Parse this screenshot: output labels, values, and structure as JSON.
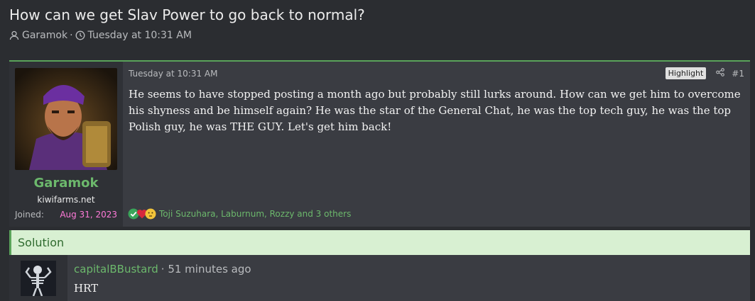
{
  "thread": {
    "title": "How can we get Slav Power to go back to normal?",
    "author": "Garamok",
    "separator": "·",
    "date": "Tuesday at 10:31 AM"
  },
  "post": {
    "date": "Tuesday at 10:31 AM",
    "highlight_label": "Highlight",
    "number": "#1",
    "body": "He seems to have stopped posting a month ago but probably still lurks around. How can we get him to overcome his shyness and be himself again? He was the star of the General Chat, he was the top tech guy, he was the top Polish guy, he was THE GUY. Let's get him back!",
    "user": {
      "name": "Garamok",
      "title": "kiwifarms.net",
      "joined_label": "Joined:",
      "joined_value": "Aug 31, 2023"
    },
    "reactions": {
      "icons": [
        "check-icon",
        "heart-icon",
        "thinking-face-icon"
      ],
      "names": "Toji Suzuhara, Laburnum, Rozzy and 3 others"
    }
  },
  "solution": {
    "label": "Solution",
    "username": "capitalBBustard",
    "time": "· 51 minutes ago",
    "body": "HRT"
  },
  "colors": {
    "accent_green": "#6cb86c",
    "joined_pink": "#ff7ad9",
    "solution_bg": "#d8f0d2"
  }
}
